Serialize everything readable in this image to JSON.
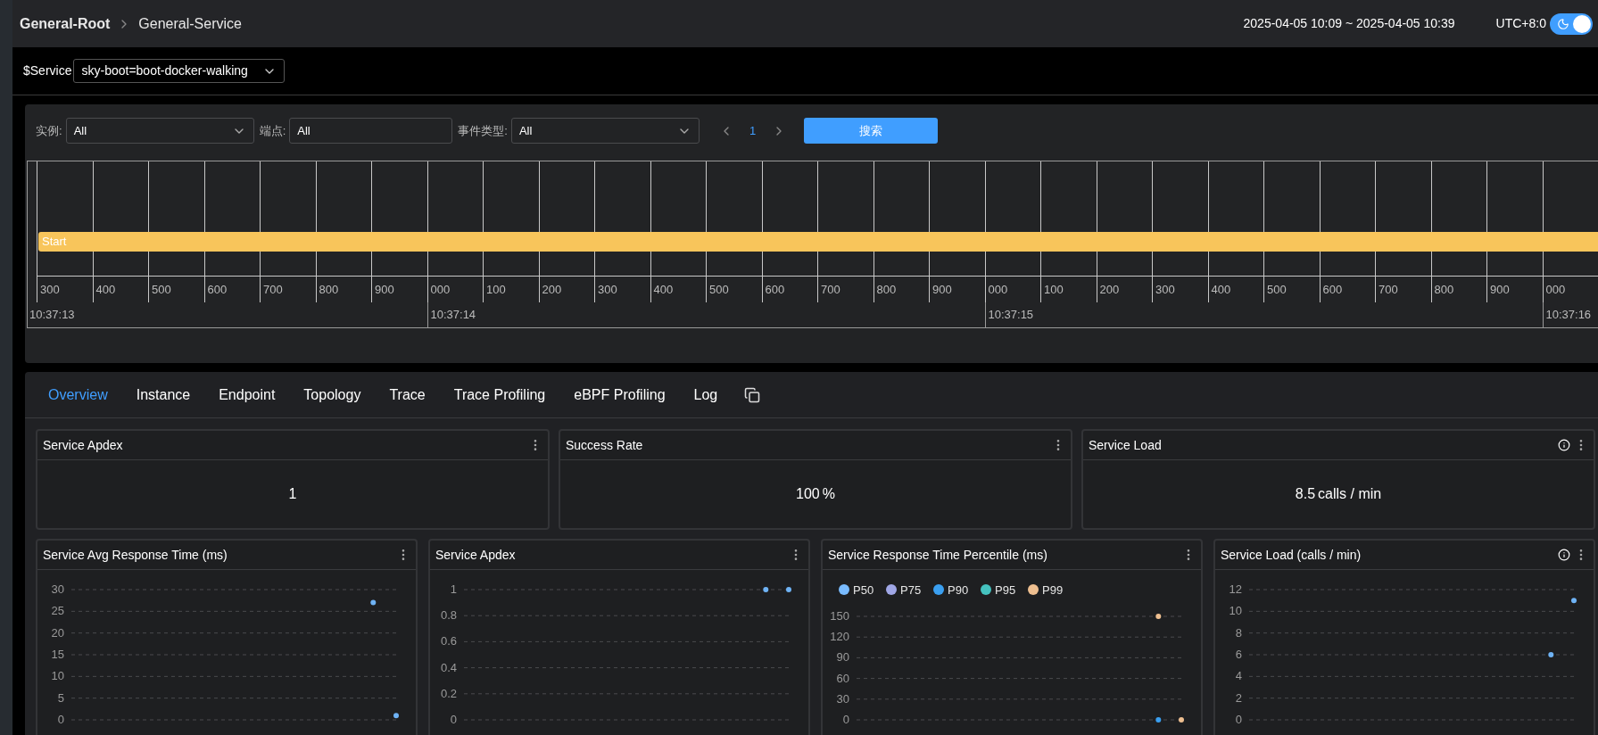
{
  "breadcrumb": {
    "root": "General-Root",
    "page": "General-Service"
  },
  "time_range": "2025-04-05 10:09 ~ 2025-04-05 10:39",
  "timezone": "UTC+8:0",
  "theme_toggle": {
    "on": true
  },
  "variables": [
    {
      "label": "$Service",
      "value": "sky-boot=boot-docker-walking"
    }
  ],
  "events": {
    "filters": [
      {
        "kind": "select",
        "label": "实例:",
        "value": "All"
      },
      {
        "kind": "input",
        "label": "端点:",
        "value": "All"
      },
      {
        "kind": "select",
        "label": "事件类型:",
        "value": "All"
      }
    ],
    "pagination": {
      "page": "1"
    },
    "search_button": "搜索",
    "timeline": {
      "bars": [
        {
          "label": "Start"
        }
      ],
      "ticks": [
        {
          "label": "300",
          "time": "10:37:13"
        },
        {
          "label": "400"
        },
        {
          "label": "500"
        },
        {
          "label": "600"
        },
        {
          "label": "700"
        },
        {
          "label": "800"
        },
        {
          "label": "900"
        },
        {
          "label": "000",
          "time": "10:37:14"
        },
        {
          "label": "100"
        },
        {
          "label": "200"
        },
        {
          "label": "300"
        },
        {
          "label": "400"
        },
        {
          "label": "500"
        },
        {
          "label": "600"
        },
        {
          "label": "700"
        },
        {
          "label": "800"
        },
        {
          "label": "900"
        },
        {
          "label": "000",
          "time": "10:37:15"
        },
        {
          "label": "100"
        },
        {
          "label": "200"
        },
        {
          "label": "300"
        },
        {
          "label": "400"
        },
        {
          "label": "500"
        },
        {
          "label": "600"
        },
        {
          "label": "700"
        },
        {
          "label": "800"
        },
        {
          "label": "900"
        },
        {
          "label": "000",
          "time": "10:37:16"
        }
      ]
    }
  },
  "tabs": [
    {
      "label": "Overview",
      "selected": true
    },
    {
      "label": "Instance",
      "selected": false
    },
    {
      "label": "Endpoint",
      "selected": false
    },
    {
      "label": "Topology",
      "selected": false
    },
    {
      "label": "Trace",
      "selected": false
    },
    {
      "label": "Trace Profiling",
      "selected": false
    },
    {
      "label": "eBPF Profiling",
      "selected": false
    },
    {
      "label": "Log",
      "selected": false
    }
  ],
  "stat_cards": [
    {
      "title": "Service Apdex",
      "value": "1"
    },
    {
      "title": "Success Rate",
      "value": "100",
      "unit": "%"
    },
    {
      "title": "Service Load",
      "value": "8.5",
      "unit": "calls / min",
      "info": true
    }
  ],
  "chart_cards": [
    {
      "title": "Service Avg Response Time (ms)",
      "chart_data": {
        "type": "scatter",
        "grid": true,
        "ylim": [
          0,
          30
        ],
        "yticks": [
          0,
          5,
          10,
          15,
          20,
          25,
          30
        ],
        "series": [
          {
            "color": "#6fb3f5",
            "values": [
              null,
              null,
              null,
              null,
              null,
              null,
              null,
              null,
              null,
              null,
              null,
              null,
              null,
              27,
              1
            ]
          }
        ]
      }
    },
    {
      "title": "Service Apdex",
      "chart_data": {
        "type": "scatter",
        "grid": true,
        "ylim": [
          0,
          1
        ],
        "yticks": [
          0,
          0.2,
          0.4,
          0.6,
          0.8,
          1
        ],
        "series": [
          {
            "color": "#6fb3f5",
            "values": [
              null,
              null,
              null,
              null,
              null,
              null,
              null,
              null,
              null,
              null,
              null,
              null,
              null,
              1,
              1
            ]
          }
        ]
      }
    },
    {
      "title": "Service Response Time Percentile (ms)",
      "chart_data": {
        "type": "scatter",
        "grid": true,
        "legend": "top",
        "ylim": [
          0,
          150
        ],
        "yticks": [
          0,
          30,
          60,
          90,
          120,
          150
        ],
        "series": [
          {
            "name": "P50",
            "color": "#79bbff",
            "values": [
              null,
              null,
              null,
              null,
              null,
              null,
              null,
              null,
              null,
              null,
              null,
              null,
              null,
              null,
              null
            ]
          },
          {
            "name": "P75",
            "color": "#a0a7e6",
            "values": [
              null,
              null,
              null,
              null,
              null,
              null,
              null,
              null,
              null,
              null,
              null,
              null,
              null,
              null,
              null
            ]
          },
          {
            "name": "P90",
            "color": "#3a9ff0",
            "values": [
              null,
              null,
              null,
              null,
              null,
              null,
              null,
              null,
              null,
              null,
              null,
              null,
              null,
              0,
              null
            ]
          },
          {
            "name": "P95",
            "color": "#45c2bf",
            "values": [
              null,
              null,
              null,
              null,
              null,
              null,
              null,
              null,
              null,
              null,
              null,
              null,
              null,
              null,
              null
            ]
          },
          {
            "name": "P99",
            "color": "#eebf90",
            "values": [
              null,
              null,
              null,
              null,
              null,
              null,
              null,
              null,
              null,
              null,
              null,
              null,
              null,
              150,
              0
            ]
          }
        ]
      }
    },
    {
      "title": "Service Load (calls / min)",
      "info": true,
      "chart_data": {
        "type": "scatter",
        "grid": true,
        "ylim": [
          0,
          12
        ],
        "yticks": [
          0,
          2,
          4,
          6,
          8,
          10,
          12
        ],
        "series": [
          {
            "color": "#6fb3f5",
            "values": [
              null,
              null,
              null,
              null,
              null,
              null,
              null,
              null,
              null,
              null,
              null,
              null,
              null,
              6,
              11
            ]
          }
        ]
      }
    }
  ]
}
